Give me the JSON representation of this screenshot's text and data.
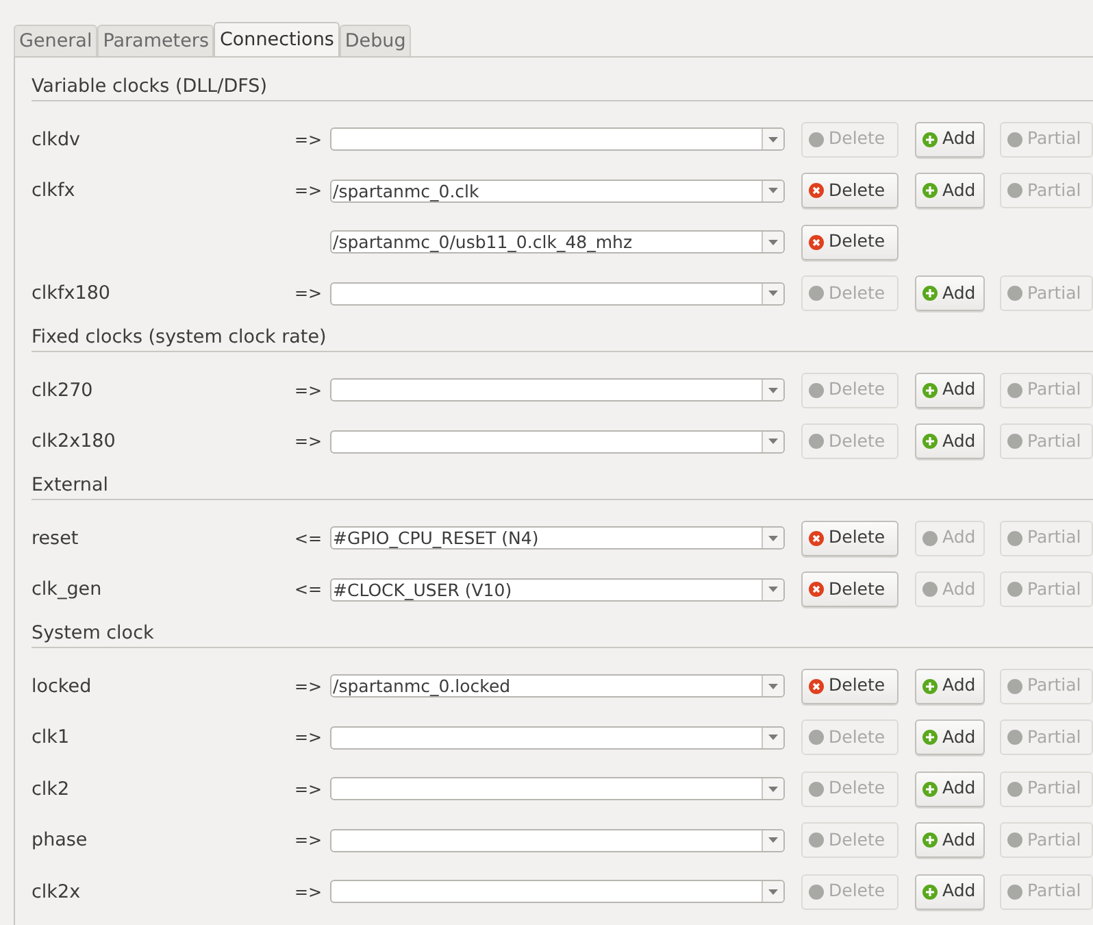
{
  "tabs": [
    {
      "label": "General",
      "selected": false
    },
    {
      "label": "Parameters",
      "selected": false
    },
    {
      "label": "Connections",
      "selected": true
    },
    {
      "label": "Debug",
      "selected": false
    }
  ],
  "sections": [
    {
      "title": "Variable clocks (DLL/DFS)",
      "rows": [
        {
          "name": "clkdv",
          "arrow": "=>",
          "value": "",
          "delete": {
            "label": "Delete",
            "disabled": true
          },
          "add": {
            "label": "Add",
            "disabled": false
          },
          "partial": {
            "label": "Partial",
            "disabled": true
          }
        },
        {
          "name": "clkfx",
          "arrow": "=>",
          "value": "/spartanmc_0.clk",
          "delete": {
            "label": "Delete",
            "disabled": false
          },
          "add": {
            "label": "Add",
            "disabled": false
          },
          "partial": {
            "label": "Partial",
            "disabled": true
          }
        },
        {
          "value": "/spartanmc_0/usb11_0.clk_48_mhz",
          "delete": {
            "label": "Delete",
            "disabled": false
          }
        },
        {
          "name": "clkfx180",
          "arrow": "=>",
          "value": "",
          "delete": {
            "label": "Delete",
            "disabled": true
          },
          "add": {
            "label": "Add",
            "disabled": false
          },
          "partial": {
            "label": "Partial",
            "disabled": true
          }
        }
      ]
    },
    {
      "title": "Fixed clocks (system clock rate)",
      "rows": [
        {
          "name": "clk270",
          "arrow": "=>",
          "value": "",
          "delete": {
            "label": "Delete",
            "disabled": true
          },
          "add": {
            "label": "Add",
            "disabled": false
          },
          "partial": {
            "label": "Partial",
            "disabled": true
          }
        },
        {
          "name": "clk2x180",
          "arrow": "=>",
          "value": "",
          "delete": {
            "label": "Delete",
            "disabled": true
          },
          "add": {
            "label": "Add",
            "disabled": false
          },
          "partial": {
            "label": "Partial",
            "disabled": true
          }
        }
      ]
    },
    {
      "title": "External",
      "rows": [
        {
          "name": "reset",
          "arrow": "<=",
          "value": "#GPIO_CPU_RESET (N4)",
          "delete": {
            "label": "Delete",
            "disabled": false
          },
          "add": {
            "label": "Add",
            "disabled": true
          },
          "partial": {
            "label": "Partial",
            "disabled": true
          }
        },
        {
          "name": "clk_gen",
          "arrow": "<=",
          "value": "#CLOCK_USER (V10)",
          "delete": {
            "label": "Delete",
            "disabled": false
          },
          "add": {
            "label": "Add",
            "disabled": true
          },
          "partial": {
            "label": "Partial",
            "disabled": true
          }
        }
      ]
    },
    {
      "title": "System clock",
      "rows": [
        {
          "name": "locked",
          "arrow": "=>",
          "value": "/spartanmc_0.locked",
          "delete": {
            "label": "Delete",
            "disabled": false
          },
          "add": {
            "label": "Add",
            "disabled": false
          },
          "partial": {
            "label": "Partial",
            "disabled": true
          }
        },
        {
          "name": "clk1",
          "arrow": "=>",
          "value": "",
          "delete": {
            "label": "Delete",
            "disabled": true
          },
          "add": {
            "label": "Add",
            "disabled": false
          },
          "partial": {
            "label": "Partial",
            "disabled": true
          }
        },
        {
          "name": "clk2",
          "arrow": "=>",
          "value": "",
          "delete": {
            "label": "Delete",
            "disabled": true
          },
          "add": {
            "label": "Add",
            "disabled": false
          },
          "partial": {
            "label": "Partial",
            "disabled": true
          }
        },
        {
          "name": "phase",
          "arrow": "=>",
          "value": "",
          "delete": {
            "label": "Delete",
            "disabled": true
          },
          "add": {
            "label": "Add",
            "disabled": false
          },
          "partial": {
            "label": "Partial",
            "disabled": true
          }
        },
        {
          "name": "clk2x",
          "arrow": "=>",
          "value": "",
          "delete": {
            "label": "Delete",
            "disabled": true
          },
          "add": {
            "label": "Add",
            "disabled": false
          },
          "partial": {
            "label": "Partial",
            "disabled": true
          }
        }
      ]
    }
  ]
}
